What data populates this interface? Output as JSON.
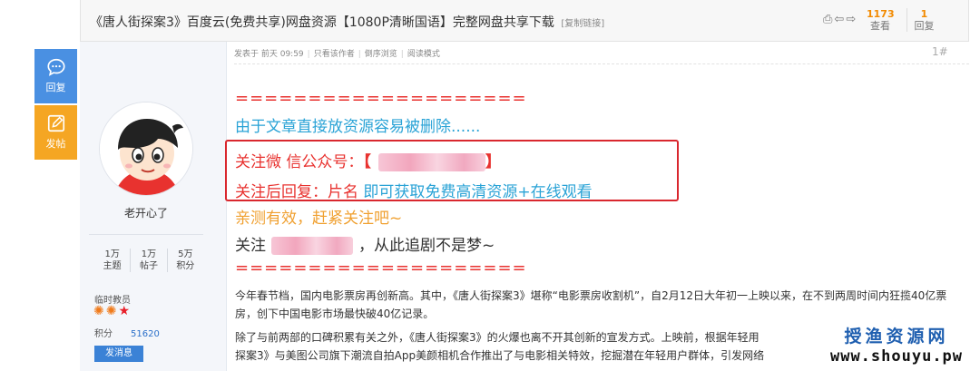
{
  "header": {
    "title": "《唐人街探案3》百度云(免费共享)网盘资源【1080P清晰国语】完整网盘共享下载",
    "copy_link": "[复制链接]",
    "views": {
      "value": "1173",
      "label": "查看"
    },
    "replies": {
      "value": "1",
      "label": "回复"
    }
  },
  "side": {
    "reply_label": "回复",
    "post_label": "发帖"
  },
  "user": {
    "name": "老开心了",
    "stats": [
      {
        "value": "1万",
        "label": "主题"
      },
      {
        "value": "1万",
        "label": "帖子"
      },
      {
        "value": "5万",
        "label": "积分"
      }
    ],
    "group": "临时教员",
    "points_label": "积分",
    "points_value": "51620",
    "message_button": "发消息"
  },
  "post": {
    "meta": {
      "posted": "发表于 前天 09:59",
      "author_only": "只看该作者",
      "reverse": "倒序浏览",
      "read_mode": "阅读模式"
    },
    "floor": "1#",
    "divider_1": "====================",
    "notice": "由于文章直接放资源容易被删除......",
    "follow_label": "关注微 信公众号：",
    "reply_prefix": "关注后回复：片名",
    "reply_suffix": "即可获取免费高清资源+在线观看",
    "tested": "亲测有效，赶紧关注吧~",
    "drama_prefix": "关注",
    "drama_suffix": "，从此追剧不是梦~",
    "divider_2": "====================",
    "para_1": "今年春节档，国内电影票房再创新高。其中，《唐人街探案3》堪称“电影票房收割机”，自2月12日大年初一上映以来，在不到两周时间内狂揽40亿票房，创下中国电影市场最快破40亿记录。",
    "para_2": "除了与前两部的口碑积累有关之外，《唐人街探案3》的火爆也离不开其创新的宣发方式。上映前，根据年轻用",
    "para_3": "探案3》与美图公司旗下潮流自拍App美颜相机合作推出了与电影相关特效，挖掘潜在年轻用户群体，引发网络"
  },
  "watermark": {
    "name": "授渔资源网",
    "url": "www.shouyu.pw"
  },
  "colors": {
    "accent_blue": "#4a90e2",
    "accent_orange": "#f5a623",
    "highlight_red": "#d9272e",
    "text_cyan": "#2aa3d6"
  }
}
